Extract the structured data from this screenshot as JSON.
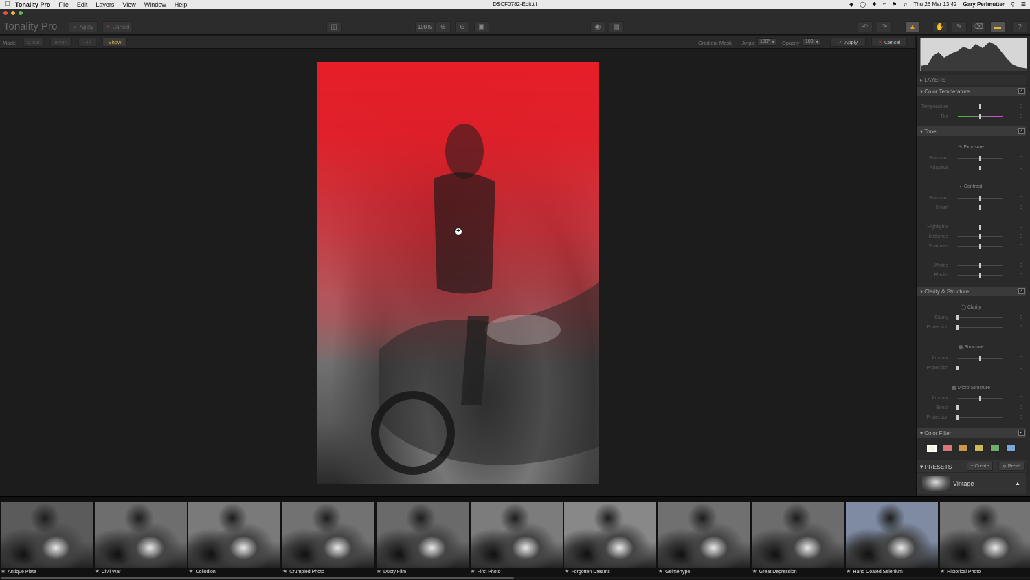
{
  "menubar": {
    "app_name": "Tonality Pro",
    "menus": [
      "File",
      "Edit",
      "Layers",
      "View",
      "Window",
      "Help"
    ],
    "document_title": "DSCF0782-Edit.tif",
    "clock": "Thu 26 Mar  13:42",
    "user": "Gary Perlmutter"
  },
  "toolbar": {
    "app_title": "Tonality Pro",
    "apply_label": "Apply",
    "cancel_label": "Cancel",
    "zoom_label": "100%"
  },
  "maskbar": {
    "mask_label": "Mask:",
    "clear": "Clear",
    "invert": "Invert",
    "fill": "Fill",
    "show": "Show",
    "gradient_label": "Gradient Mask:",
    "angle_label": "Angle",
    "angle_value": "180°",
    "opacity_label": "Opacity",
    "opacity_value": "100",
    "apply": "Apply",
    "cancel": "Cancel"
  },
  "panel": {
    "layers_title": "LAYERS",
    "color_temp": {
      "title": "Color Temperature",
      "temperature_label": "Temperature",
      "temperature_value": "0",
      "tint_label": "Tint",
      "tint_value": "0"
    },
    "tone": {
      "title": "Tone",
      "exposure_title": "Exposure",
      "standard_label": "Standard",
      "standard_value": "0",
      "adaptive_label": "Adaptive",
      "adaptive_value": "0",
      "contrast_title": "Contrast",
      "c_standard_label": "Standard",
      "c_standard_value": "0",
      "smart_label": "Smart",
      "smart_value": "0",
      "highlights_label": "Highlights",
      "highlights_value": "0",
      "midtones_label": "Midtones",
      "midtones_value": "0",
      "shadows_label": "Shadows",
      "shadows_value": "0",
      "whites_label": "Whites",
      "whites_value": "0",
      "blacks_label": "Blacks",
      "blacks_value": "0"
    },
    "clarity": {
      "title": "Clarity & Structure",
      "clarity_title": "Clarity",
      "clarity_label": "Clarity",
      "clarity_value": "0",
      "protection_label": "Protection",
      "protection_value": "0",
      "structure_title": "Structure",
      "amount_label": "Amount",
      "amount_value": "0",
      "s_protection_label": "Protection",
      "s_protection_value": "0",
      "micro_title": "Micro Structure",
      "m_amount_label": "Amount",
      "m_amount_value": "0",
      "boost_label": "Boost",
      "boost_value": "0",
      "m_protection_label": "Protection",
      "m_protection_value": "0"
    },
    "color_filter": {
      "title": "Color Filter",
      "swatches": [
        "#f5f2e6",
        "#d8787a",
        "#c9984e",
        "#c9bd52",
        "#6fae6c",
        "#79a6d2"
      ]
    },
    "presets": {
      "title": "PRESETS",
      "create": "Create",
      "reset": "Reset",
      "current": "Vintage"
    }
  },
  "filmstrip": {
    "items": [
      {
        "label": "Antique Plate",
        "tone": "#5b5b5b"
      },
      {
        "label": "Civil War",
        "tone": "#6e6e6e"
      },
      {
        "label": "Collodion",
        "tone": "#7a7a7a"
      },
      {
        "label": "Crumpled Photo",
        "tone": "#727272"
      },
      {
        "label": "Dusty Film",
        "tone": "#6a6a6a"
      },
      {
        "label": "First Photo",
        "tone": "#7c7c7c"
      },
      {
        "label": "Forgotten Dreams",
        "tone": "#888888"
      },
      {
        "label": "Gelmertype",
        "tone": "#707070"
      },
      {
        "label": "Great Depression",
        "tone": "#6c6c6c"
      },
      {
        "label": "Hand Coated Selenium",
        "tone": "#7e8ba3"
      },
      {
        "label": "Historical Photo",
        "tone": "#747474"
      }
    ]
  }
}
